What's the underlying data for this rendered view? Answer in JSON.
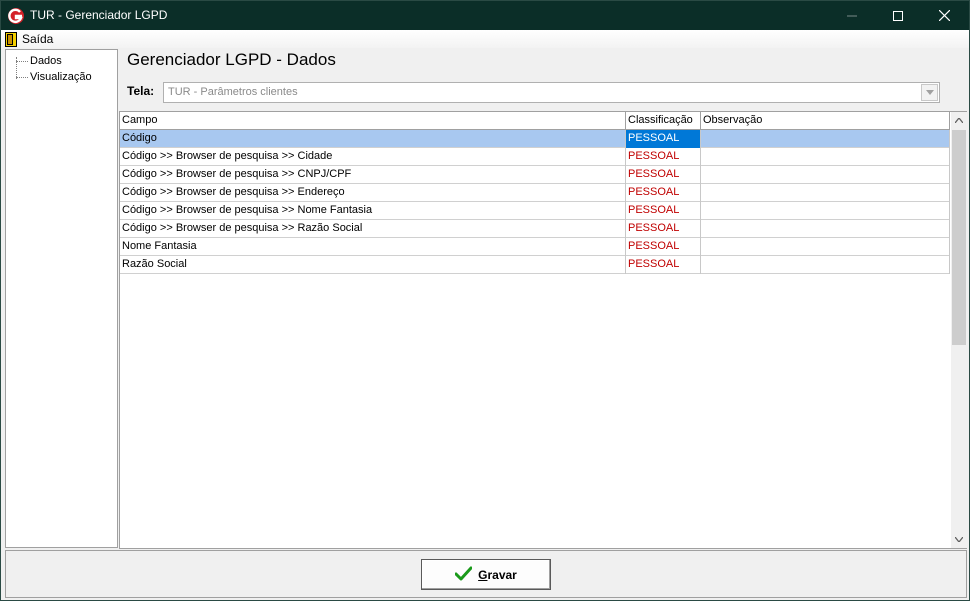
{
  "window": {
    "title": "TUR - Gerenciador LGPD"
  },
  "menu": {
    "exit_label": "Saída"
  },
  "tree": {
    "items": [
      {
        "label": "Dados"
      },
      {
        "label": "Visualização"
      }
    ]
  },
  "page": {
    "title": "Gerenciador LGPD - Dados"
  },
  "tela": {
    "label": "Tela:",
    "value": "TUR - Parâmetros clientes"
  },
  "grid": {
    "columns": [
      "Campo",
      "Classificação",
      "Observação"
    ],
    "rows": [
      {
        "campo": "Código",
        "classificacao": "PESSOAL",
        "observacao": ""
      },
      {
        "campo": "Código >> Browser de pesquisa >> Cidade",
        "classificacao": "PESSOAL",
        "observacao": ""
      },
      {
        "campo": "Código >> Browser de pesquisa >> CNPJ/CPF",
        "classificacao": "PESSOAL",
        "observacao": ""
      },
      {
        "campo": "Código >> Browser de pesquisa >> Endereço",
        "classificacao": "PESSOAL",
        "observacao": ""
      },
      {
        "campo": "Código >> Browser de pesquisa >> Nome Fantasia",
        "classificacao": "PESSOAL",
        "observacao": ""
      },
      {
        "campo": "Código >> Browser de pesquisa >> Razão Social",
        "classificacao": "PESSOAL",
        "observacao": ""
      },
      {
        "campo": "Nome Fantasia",
        "classificacao": "PESSOAL",
        "observacao": ""
      },
      {
        "campo": "Razão Social",
        "classificacao": "PESSOAL",
        "observacao": ""
      }
    ]
  },
  "buttons": {
    "save_first": "G",
    "save_rest": "ravar"
  },
  "colors": {
    "titlebar": "#0b2e28",
    "classification_text": "#c00000",
    "selection": "#0078d7"
  }
}
